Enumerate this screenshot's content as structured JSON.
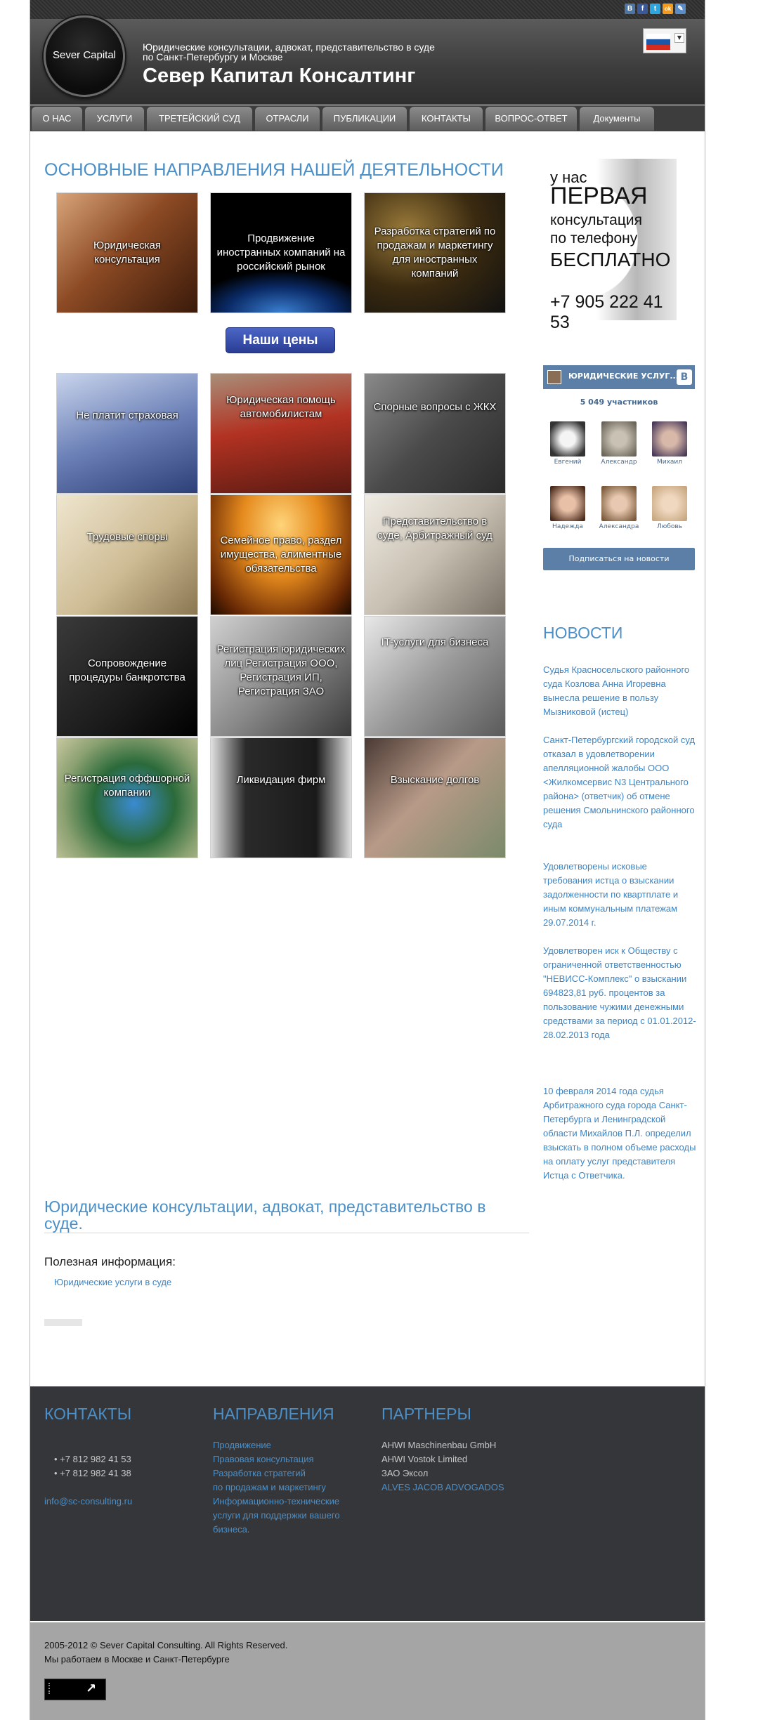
{
  "social": [
    "В",
    "f",
    "t",
    "ok",
    "✎"
  ],
  "colors": {
    "accent": "#4a8fc7",
    "link": "#3b84c4",
    "vk": "#5b7fa6",
    "nav_bg": "#3d3d3d",
    "footer_dark": "#35363a",
    "footer_light": "#a5a5a5"
  },
  "header": {
    "logo_text": "Sever Capital",
    "tagline_1": "Юридические консультации, адвокат, представительство в суде",
    "tagline_2": "по Санкт-Петербургу и Москве",
    "title": "Север Капитал Консалтинг",
    "language_flag": "russia-flag-icon"
  },
  "nav": [
    "О НАС",
    "УСЛУГИ",
    "ТРЕТЕЙСКИЙ СУД",
    "ОТРАСЛИ",
    "ПУБЛИКАЦИИ",
    "КОНТАКТЫ",
    "ВОПРОС-ОТВЕТ",
    "Документы"
  ],
  "main": {
    "section_title": "ОСНОВНЫЕ НАПРАВЛЕНИЯ НАШЕЙ ДЕЯТЕЛЬНОСТИ",
    "top_tiles": [
      "Юридическая консультация",
      "Продвижение иностранных компаний на российский рынок",
      "Разработка стратегий по продажам и маркетингу для иностранных компаний"
    ],
    "prices_button": "Наши цены",
    "service_tiles": [
      "Не платит страховая",
      "Юридическая помощь автомобилистам",
      "Спорные вопросы с ЖКХ",
      "Трудовые споры",
      "Семейное право, раздел имущества, алиментные обязательства",
      "Представительство в суде, Арбитражный суд",
      "Сопровождение процедуры банкротства",
      "Регистрация юридических лиц Регистрация ООО, Регистрация ИП, Регистрация ЗАО",
      "IT-услуги для бизнеса",
      "Регистрация оффшорной компании",
      "Ликвидация фирм",
      "Взыскание долгов"
    ],
    "bottom_heading": "Юридические консультации, адвокат, представительство в суде.",
    "useful_title": "Полезная информация:",
    "useful_link": "Юридические услуги в суде"
  },
  "promo": {
    "line1": "у нас",
    "line2": "ПЕРВАЯ",
    "line3": "консультация",
    "line4": "по телефону",
    "line5": "БЕСПЛАТНО",
    "phone": "+7 905 222 41 53"
  },
  "vk": {
    "group_name": "ЮРИДИЧЕСКИЕ УСЛУГ...",
    "members_count": "5 049 участников",
    "members": [
      "Евгений",
      "Александр",
      "Михаил",
      "Надежда",
      "Александра",
      "Любовь"
    ],
    "subscribe": "Подписаться на новости"
  },
  "news": {
    "title": "НОВОСТИ",
    "items": [
      "Судья Красносельского районного суда Козлова Анна Игоревна вынесла решение в пользу Мызниковой (истец)",
      "Санкт-Петербургский городской суд отказал в удовлетворении апелляционной жалобы ООО <Жилкомсервис N3 Центрального района> (ответчик) об отмене решения Смольнинского районного суда",
      "Удовлетворены исковые требования истца о взыскании задолженности по квартплате и иным коммунальным платежам 29.07.2014 г.",
      "Удовлетворен иск к Обществу с ограниченной ответственностью \"НЕВИСС-Комплекс\" о взыскании 694823,81 руб. процентов за пользование чужими денежными средствами за период с 01.01.2012-28.02.2013 года",
      "10 февраля 2014 года судья Арбитражного суда города Санкт-Петербурга и Ленинградской области Михайлов П.Л. определил взыскать в полном объеме расходы на оплату услуг представителя Истца с Ответчика."
    ]
  },
  "footer": {
    "contacts_title": "КОНТАКТЫ",
    "phones": [
      "+7 812 982 41 53",
      "+7 812 982 41 38"
    ],
    "email": "info@sc-consulting.ru",
    "directions_title": "НАПРАВЛЕНИЯ",
    "directions": [
      "Продвижение",
      "Правовая консультация",
      "Разработка стратегий",
      "по продажам и маркетингу",
      "Информационно-технические",
      "услуги для поддержки вашего",
      "бизнеса."
    ],
    "partners_title": "ПАРТНЕРЫ",
    "partners": [
      "AHWI Maschinenbau GmbH",
      "AHWI Vostok Limited",
      "ЗАО Эксол"
    ],
    "partner_link": "ALVES JACOB ADVOGADOS",
    "copyright_1": "2005-2012 © Sever Capital Consulting. All Rights Reserved.",
    "copyright_2": "Мы работаем в Москве и Санкт-Петербурге",
    "counter_text": "↗"
  }
}
